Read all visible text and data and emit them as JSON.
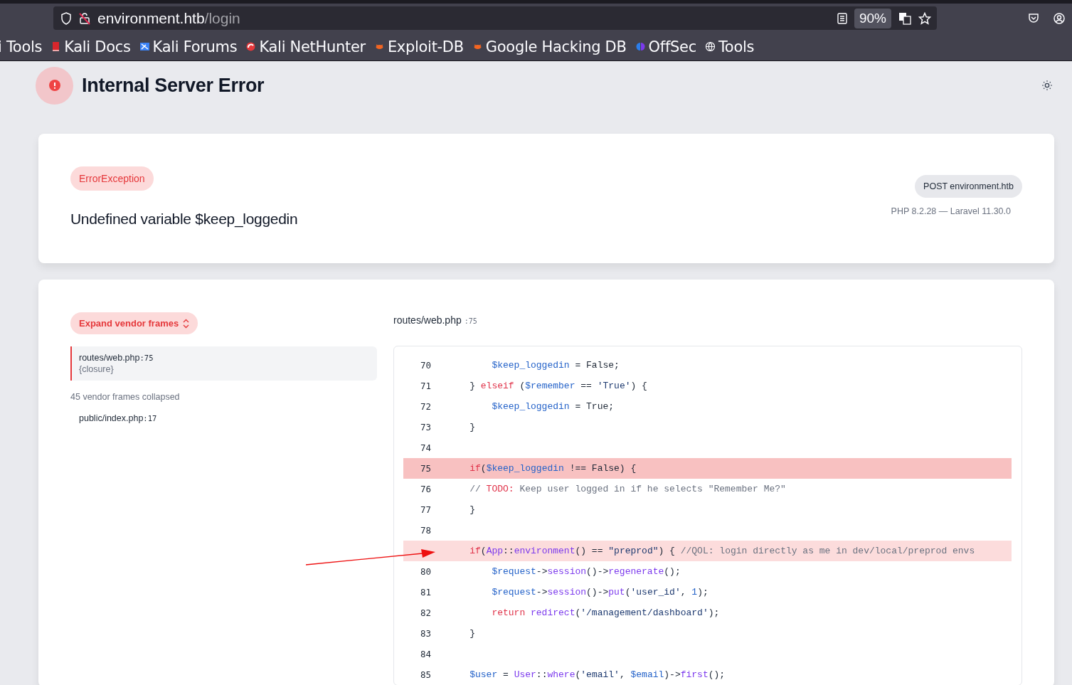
{
  "browser": {
    "url_host": "environment.htb",
    "url_path": "/login",
    "zoom": "90%",
    "bookmarks": [
      {
        "label": "i Tools"
      },
      {
        "label": "Kali Docs"
      },
      {
        "label": "Kali Forums"
      },
      {
        "label": "Kali NetHunter"
      },
      {
        "label": "Exploit-DB"
      },
      {
        "label": "Google Hacking DB"
      },
      {
        "label": "OffSec"
      },
      {
        "label": "Tools"
      }
    ]
  },
  "page": {
    "title": "Internal Server Error"
  },
  "error": {
    "type": "ErrorException",
    "message": "Undefined variable $keep_loggedin",
    "request": "POST environment.htb",
    "versions": "PHP 8.2.28 — Laravel 11.30.0"
  },
  "trace": {
    "expand_button": "Expand vendor frames",
    "frames": [
      {
        "file": "routes/web.php",
        "line": ":75",
        "function": "{closure}",
        "selected": true
      },
      {
        "file": "public/index.php",
        "line": ":17",
        "selected": false
      }
    ],
    "collapsed_note": "45 vendor frames collapsed"
  },
  "source": {
    "file": "routes/web.php",
    "line": ":75",
    "lines": [
      {
        "number": "70",
        "kind": "normal",
        "tokens": [
          {
            "t": "        $keep_loggedin",
            "color": "#2563c9"
          },
          {
            "t": " = False;"
          }
        ]
      },
      {
        "number": "71",
        "kind": "normal",
        "tokens": [
          {
            "t": "    } "
          },
          {
            "t": "elseif",
            "color": "#e0334a"
          },
          {
            "t": " ("
          },
          {
            "t": "$remember",
            "color": "#2563c9"
          },
          {
            "t": " == "
          },
          {
            "t": "'True'",
            "color": "#1e3a70"
          },
          {
            "t": ") {"
          }
        ]
      },
      {
        "number": "72",
        "kind": "normal",
        "tokens": [
          {
            "t": "        $keep_loggedin",
            "color": "#2563c9"
          },
          {
            "t": " = True;"
          }
        ]
      },
      {
        "number": "73",
        "kind": "normal",
        "tokens": [
          {
            "t": "    }"
          }
        ]
      },
      {
        "number": "74",
        "kind": "normal"
      },
      {
        "number": "75",
        "kind": "error",
        "tokens": [
          {
            "t": "    if",
            "color": "#e0334a"
          },
          {
            "t": "("
          },
          {
            "t": "$keep_loggedin",
            "color": "#2563c9"
          },
          {
            "t": " !== False) {"
          }
        ]
      },
      {
        "number": "76",
        "kind": "normal",
        "tokens": [
          {
            "t": "    // ",
            "color": "#6b7280"
          },
          {
            "t": "TODO:",
            "color": "#e0334a"
          },
          {
            "t": " Keep user logged in if he selects \"Remember Me?\"",
            "color": "#6b7280"
          }
        ]
      },
      {
        "number": "77",
        "kind": "normal",
        "tokens": [
          {
            "t": "    }"
          }
        ]
      },
      {
        "number": "78",
        "kind": "normal"
      },
      {
        "kind": "marked",
        "tokens": [
          {
            "t": "    if",
            "color": "#e0334a"
          },
          {
            "t": "("
          },
          {
            "t": "App",
            "color": "#7c3aed"
          },
          {
            "t": "::"
          },
          {
            "t": "environment",
            "color": "#7c3aed"
          },
          {
            "t": "() == "
          },
          {
            "t": "\"preprod\"",
            "color": "#1e3a70"
          },
          {
            "t": ") { "
          },
          {
            "t": "//QOL: login directly as me in dev/local/preprod envs",
            "color": "#6b7280"
          }
        ]
      },
      {
        "number": "80",
        "kind": "normal",
        "tokens": [
          {
            "t": "        $request",
            "color": "#2563c9"
          },
          {
            "t": "->"
          },
          {
            "t": "session",
            "color": "#7c3aed"
          },
          {
            "t": "()->"
          },
          {
            "t": "regenerate",
            "color": "#7c3aed"
          },
          {
            "t": "();"
          }
        ]
      },
      {
        "number": "81",
        "kind": "normal",
        "tokens": [
          {
            "t": "        $request",
            "color": "#2563c9"
          },
          {
            "t": "->"
          },
          {
            "t": "session",
            "color": "#7c3aed"
          },
          {
            "t": "()->"
          },
          {
            "t": "put",
            "color": "#7c3aed"
          },
          {
            "t": "("
          },
          {
            "t": "'user_id'",
            "color": "#1e3a70"
          },
          {
            "t": ", "
          },
          {
            "t": "1",
            "color": "#2563c9"
          },
          {
            "t": ");"
          }
        ]
      },
      {
        "number": "82",
        "kind": "normal",
        "tokens": [
          {
            "t": "        return",
            "color": "#e0334a"
          },
          {
            "t": " redirect",
            "color": "#7c3aed"
          },
          {
            "t": "("
          },
          {
            "t": "'/management/dashboard'",
            "color": "#1e3a70"
          },
          {
            "t": ");"
          }
        ]
      },
      {
        "number": "83",
        "kind": "normal",
        "tokens": [
          {
            "t": "    }"
          }
        ]
      },
      {
        "number": "84",
        "kind": "normal"
      },
      {
        "number": "85",
        "kind": "normal",
        "tokens": [
          {
            "t": "    $user",
            "color": "#2563c9"
          },
          {
            "t": " = "
          },
          {
            "t": "User",
            "color": "#7c3aed"
          },
          {
            "t": "::"
          },
          {
            "t": "where",
            "color": "#7c3aed"
          },
          {
            "t": "("
          },
          {
            "t": "'email'",
            "color": "#1e3a70"
          },
          {
            "t": ", "
          },
          {
            "t": "$email",
            "color": "#2563c9"
          },
          {
            "t": ")->"
          },
          {
            "t": "first",
            "color": "#7c3aed"
          },
          {
            "t": "();"
          }
        ]
      }
    ]
  }
}
